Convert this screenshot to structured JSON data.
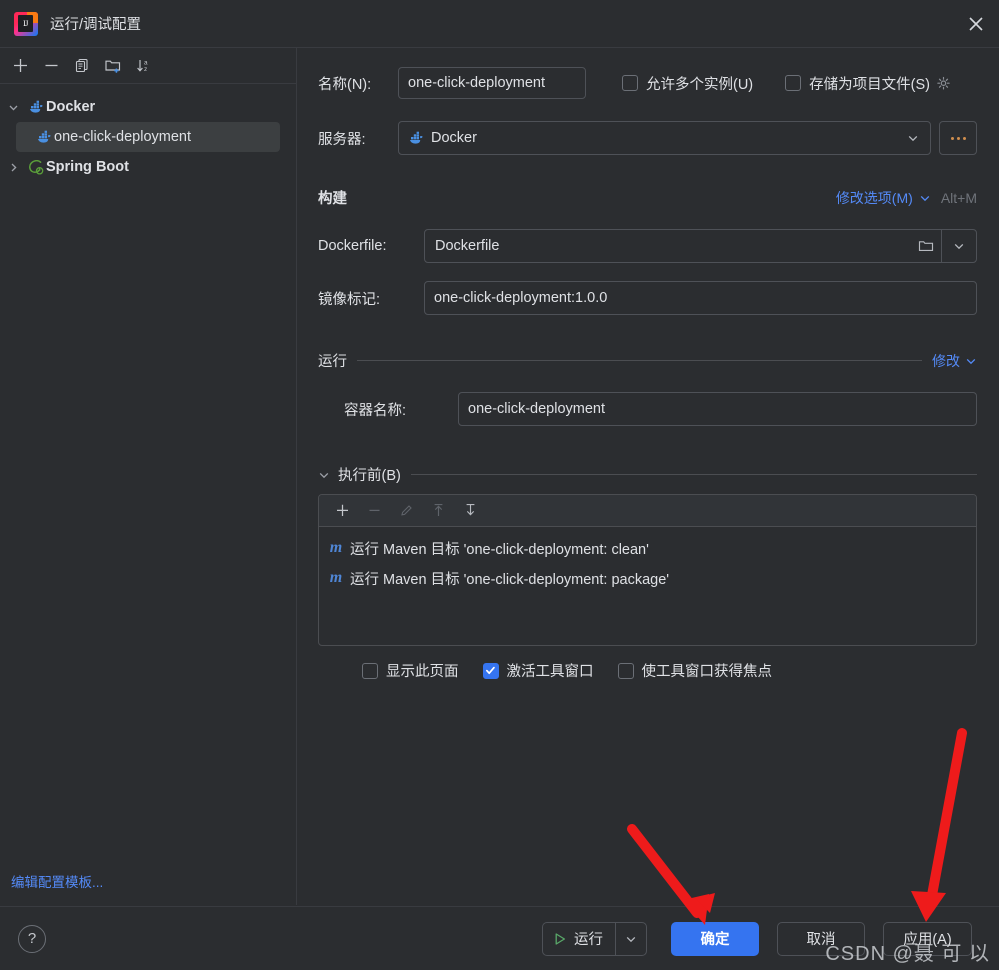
{
  "window": {
    "title": "运行/调试配置",
    "app_icon": "intellij-idea-logo",
    "close_icon": "close-icon"
  },
  "left_panel": {
    "toolbar": [
      {
        "name": "add-configuration-button",
        "icon": "plus-icon"
      },
      {
        "name": "remove-configuration-button",
        "icon": "minus-icon"
      },
      {
        "name": "copy-configuration-button",
        "icon": "copy-icon"
      },
      {
        "name": "new-folder-button",
        "icon": "folder-add-icon"
      },
      {
        "name": "sort-configurations-button",
        "icon": "sort-az-icon"
      }
    ],
    "tree": [
      {
        "label": "Docker",
        "icon": "docker-icon",
        "expanded": true,
        "level": 0,
        "bold": true,
        "selected": false
      },
      {
        "label": "one-click-deployment",
        "icon": "docker-icon",
        "expanded": null,
        "level": 1,
        "bold": false,
        "selected": true
      },
      {
        "label": "Spring Boot",
        "icon": "spring-boot-icon",
        "expanded": false,
        "level": 0,
        "bold": true,
        "selected": false
      }
    ],
    "edit_templates_link": "编辑配置模板..."
  },
  "form": {
    "name_label": "名称(N):",
    "name_value": "one-click-deployment",
    "allow_multiple_label": "允许多个实例(U)",
    "allow_multiple_checked": false,
    "store_as_project_file_label": "存储为项目文件(S)",
    "store_as_project_file_checked": false,
    "gear_icon": "gear-icon",
    "server_label": "服务器:",
    "server_value": "Docker",
    "server_icon": "docker-icon",
    "server_more_button": "...",
    "build": {
      "title": "构建",
      "modify_options_link": "修改选项(M)",
      "modify_options_shortcut": "Alt+M",
      "dockerfile_label": "Dockerfile:",
      "dockerfile_value": "Dockerfile",
      "dockerfile_browse_icon": "folder-icon",
      "dockerfile_history_icon": "chevron-down-icon",
      "image_tag_label": "镜像标记:",
      "image_tag_value": "one-click-deployment:1.0.0"
    },
    "run": {
      "title": "运行",
      "modify_link": "修改",
      "container_name_label": "容器名称:",
      "container_name_value": "one-click-deployment"
    },
    "before_launch": {
      "title": "执行前(B)",
      "expanded": true,
      "toolbar": [
        {
          "name": "add-task-button",
          "icon": "plus-icon",
          "enabled": true
        },
        {
          "name": "remove-task-button",
          "icon": "minus-icon",
          "enabled": false
        },
        {
          "name": "edit-task-button",
          "icon": "pencil-icon",
          "enabled": false
        },
        {
          "name": "move-task-up-button",
          "icon": "arrow-up-icon",
          "enabled": false
        },
        {
          "name": "move-task-down-button",
          "icon": "arrow-down-icon",
          "enabled": true
        }
      ],
      "tasks": [
        {
          "icon": "maven-icon",
          "label": "运行 Maven 目标 'one-click-deployment: clean'"
        },
        {
          "icon": "maven-icon",
          "label": "运行 Maven 目标 'one-click-deployment: package'"
        }
      ],
      "options": [
        {
          "label": "显示此页面",
          "checked": false
        },
        {
          "label": "激活工具窗口",
          "checked": true
        },
        {
          "label": "使工具窗口获得焦点",
          "checked": false
        }
      ]
    }
  },
  "bottom_bar": {
    "help_label": "?",
    "run_label": "运行",
    "run_icon": "play-icon",
    "run_dropdown_icon": "chevron-down-icon",
    "ok_label": "确定",
    "cancel_label": "取消",
    "apply_label": "应用(A)"
  },
  "annotations": {
    "arrow_count": 2,
    "arrow_color": "#ee1b1b",
    "watermark": "CSDN @聂 可 以"
  },
  "colors": {
    "background": "#2b2d30",
    "accent_blue": "#3574f0",
    "link_blue": "#548af7",
    "border": "#4e5157",
    "text": "#dfe1e5",
    "docker_blue": "#4a90e2",
    "spring_green": "#5a9e3a"
  }
}
